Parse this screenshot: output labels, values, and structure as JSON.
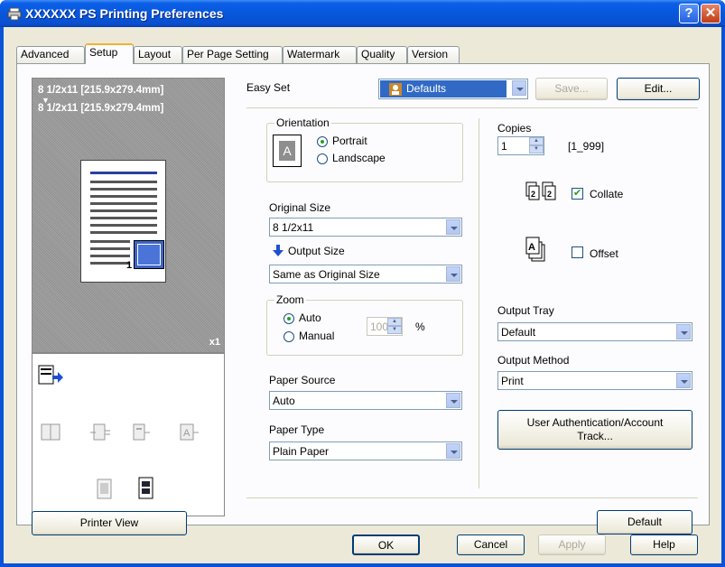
{
  "window": {
    "title": "XXXXXX PS Printing Preferences",
    "help_glyph": "?",
    "close_glyph": "✕"
  },
  "tabs": [
    {
      "label": "Advanced"
    },
    {
      "label": "Setup"
    },
    {
      "label": "Layout"
    },
    {
      "label": "Per Page Setting"
    },
    {
      "label": "Watermark"
    },
    {
      "label": "Quality"
    },
    {
      "label": "Version"
    }
  ],
  "active_tab": "Setup",
  "preview": {
    "line1": "8 1/2x11 [215.9x279.4mm]",
    "line2": "8 1/2x11 [215.9x279.4mm]",
    "page_number": "1",
    "copies_badge": "x1",
    "printer_view_button": "Printer View"
  },
  "easy_set": {
    "label": "Easy Set",
    "value": "Defaults",
    "save_button": "Save...",
    "edit_button": "Edit..."
  },
  "orientation": {
    "legend": "Orientation",
    "portrait": "Portrait",
    "landscape": "Landscape",
    "selected": "Portrait",
    "icon_letter": "A"
  },
  "original_size": {
    "label": "Original Size",
    "value": "8 1/2x11"
  },
  "output_size": {
    "label": "Output Size",
    "value": "Same as Original Size"
  },
  "zoom": {
    "legend": "Zoom",
    "auto": "Auto",
    "manual": "Manual",
    "selected": "Auto",
    "value": "100",
    "unit": "%"
  },
  "paper_source": {
    "label": "Paper Source",
    "value": "Auto"
  },
  "paper_type": {
    "label": "Paper Type",
    "value": "Plain Paper"
  },
  "copies": {
    "label": "Copies",
    "value": "1",
    "range": "[1_999]"
  },
  "collate": {
    "label": "Collate",
    "checked": true
  },
  "offset": {
    "label": "Offset",
    "checked": false
  },
  "output_tray": {
    "label": "Output Tray",
    "value": "Default"
  },
  "output_method": {
    "label": "Output Method",
    "value": "Print"
  },
  "user_auth_button": {
    "line1": "User Authentication/Account",
    "line2": "Track..."
  },
  "default_button": "Default",
  "footer": {
    "ok": "OK",
    "cancel": "Cancel",
    "apply": "Apply",
    "help": "Help"
  }
}
